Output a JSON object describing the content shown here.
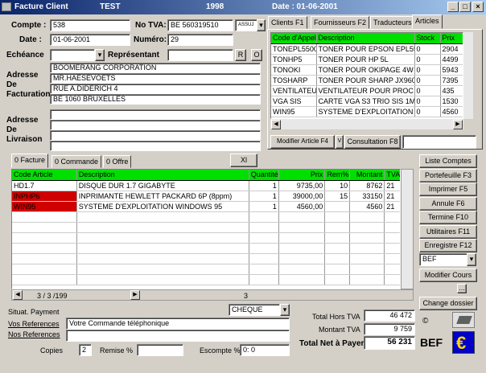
{
  "window": {
    "title": "Facture Client",
    "year_label": "TEST",
    "year": "1998",
    "date_label": "Date : 01-06-2001"
  },
  "header": {
    "compte_label": "Compte :",
    "compte": "538",
    "date_label": "Date :",
    "date": "01-06-2001",
    "echeance_label": "Echéance",
    "echeance": "",
    "tva_label": "No TVA:",
    "tva": "BE 560319510",
    "assuj": "ASSUJ",
    "numero_label": "Numéro:",
    "numero": "29",
    "representant_label": "Représentant",
    "representant": "",
    "rep_btn1": "R",
    "rep_btn2": "O"
  },
  "adresse_fact": {
    "label1": "Adresse",
    "label2": "De",
    "label3": "Facturation",
    "lines": [
      "BOOMERANG CORPORATION",
      "MR.HAESEVOETS",
      "RUE A.DIDERICH 4",
      "BE  1060  BRUXELLES"
    ]
  },
  "adresse_liv": {
    "label1": "Adresse",
    "label2": "De",
    "label3": "Livraison",
    "lines": [
      "",
      "",
      "",
      ""
    ]
  },
  "right_tabs": [
    "Clients   F1",
    "Fournisseurs  F2",
    "Traducteurs",
    "Articles"
  ],
  "articles": {
    "headers": [
      "Code d'Appel",
      "Description",
      "Stock",
      "Prix"
    ],
    "rows": [
      [
        "TONEPL5500",
        "TONER POUR EPSON EPL55",
        "0",
        "2904"
      ],
      [
        "TONHP5",
        "TONER POUR HP 5L",
        "0",
        "4499"
      ],
      [
        "TONOKI",
        "TONER POUR OKIPAGE 4W",
        "0",
        "5943"
      ],
      [
        "TOSHARP",
        "TONER POUR SHARP JX960",
        "0",
        "7395"
      ],
      [
        "VENTILATEU",
        "VENTILATEUR POUR PROC",
        "0",
        "435"
      ],
      [
        "VGA SIS",
        "CARTE VGA S3 TRIO SIS 1M",
        "0",
        "1530"
      ],
      [
        "WIN95",
        "SYSTEME D'EXPLOITATION",
        "0",
        "4560"
      ]
    ],
    "modifier_btn": "Modifier Article  F4",
    "v_btn": "V",
    "consultation_btn": "Consultation  F8"
  },
  "lower_tabs": [
    "0 Facture",
    "0 Commande",
    "0 Offre"
  ],
  "xl_btn": "Xl",
  "lines": {
    "headers": [
      "Code Article",
      "Description",
      "Quantité",
      "Prix",
      "Rem%",
      "Montant",
      "TVA"
    ],
    "rows": [
      [
        "HD1.7",
        "DISQUE DUR 1.7 GIGABYTE",
        "1",
        "9735,00",
        "10",
        "8762",
        "21"
      ],
      [
        "INPHP6",
        "INPRIMANTE HEWLETT PACKARD 6P (8ppm)",
        "1",
        "39000,00",
        "15",
        "33150",
        "21"
      ],
      [
        "WIN95",
        "SYSTEME D'EXPLOITATION WINDOWS 95",
        "1",
        "4560,00",
        "",
        "4560",
        "21"
      ]
    ],
    "footer_count": "3 / 3 /199",
    "footer_qty": "3"
  },
  "right_buttons": [
    "Liste Comptes",
    "Portefeuille   F3",
    "Imprimer      F5",
    "Annule       F6",
    "Termine     F10",
    "Utilitaires    F11",
    "Enregistre  F12"
  ],
  "currency": "BEF",
  "modifier_cours": "Modifier Cours",
  "dots_btn": "...",
  "change_dossier": "Change dossier",
  "bottom": {
    "situat_label": "Situat. Payment",
    "situat": "CHEQUE",
    "vos_ref_label": "Vos References",
    "vos_ref": "Votre Commande téléphonique",
    "nos_ref_label": "Nos References",
    "nos_ref": "",
    "copies_label": "Copies",
    "copies": "2",
    "remise_label": "Remise %",
    "remise": "",
    "escompte_label": "Escompte %",
    "escompte": "0: 0",
    "total_htva_label": "Total Hors TVA",
    "total_htva": "46 472",
    "montant_tva_label": "Montant TVA",
    "montant_tva": "9 759",
    "total_net_label": "Total Net à Payer",
    "total_net": "56 231",
    "copyright": "©",
    "bef_label": "BEF",
    "euro": "€"
  }
}
